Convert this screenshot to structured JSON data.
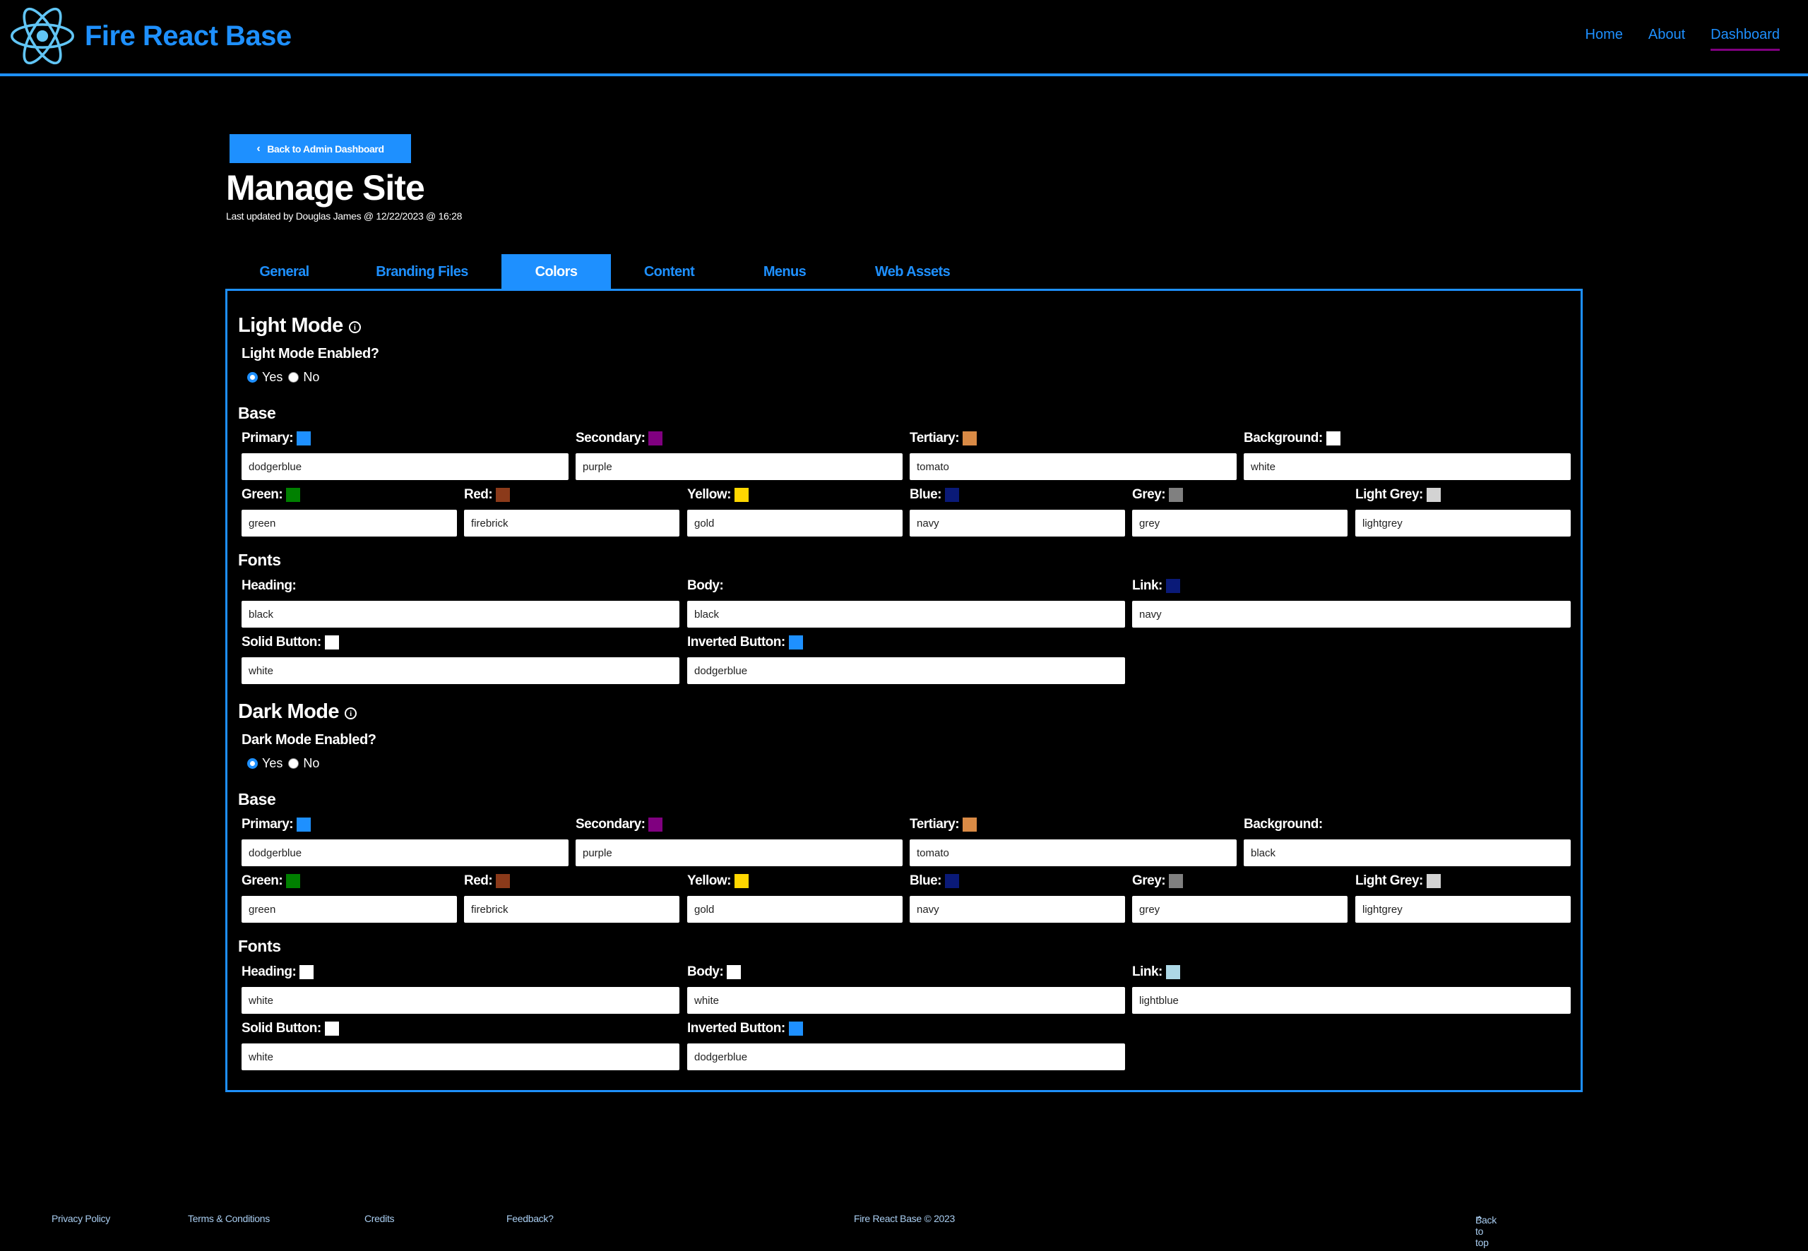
{
  "header": {
    "brand_title": "Fire React Base",
    "nav": [
      {
        "label": "Home",
        "active": false
      },
      {
        "label": "About",
        "active": false
      },
      {
        "label": "Dashboard",
        "active": true
      }
    ]
  },
  "page": {
    "back_button_label": "Back to Admin Dashboard",
    "title": "Manage Site",
    "last_updated": "Last updated by Douglas James @ 12/22/2023 @ 16:28"
  },
  "tabs": [
    {
      "label": "General",
      "active": false
    },
    {
      "label": "Branding Files",
      "active": false
    },
    {
      "label": "Colors",
      "active": true
    },
    {
      "label": "Content",
      "active": false
    },
    {
      "label": "Menus",
      "active": false
    },
    {
      "label": "Web Assets",
      "active": false
    }
  ],
  "light_mode": {
    "title": "Light Mode",
    "enabled_question": "Light Mode Enabled?",
    "yes_label": "Yes",
    "no_label": "No",
    "enabled": "Yes",
    "base_heading": "Base",
    "fonts_heading": "Fonts",
    "base": {
      "primary": {
        "label": "Primary:",
        "value": "dodgerblue",
        "swatch": "#1e90ff"
      },
      "secondary": {
        "label": "Secondary:",
        "value": "purple",
        "swatch": "#800080"
      },
      "tertiary": {
        "label": "Tertiary:",
        "value": "tomato",
        "swatch": "#d98a45"
      },
      "background": {
        "label": "Background:",
        "value": "white",
        "swatch": "#ffffff"
      },
      "green": {
        "label": "Green:",
        "value": "green",
        "swatch": "#008000"
      },
      "red": {
        "label": "Red:",
        "value": "firebrick",
        "swatch": "#8b3a1a"
      },
      "yellow": {
        "label": "Yellow:",
        "value": "gold",
        "swatch": "#ffd700"
      },
      "blue": {
        "label": "Blue:",
        "value": "navy",
        "swatch": "#0a1a78"
      },
      "grey": {
        "label": "Grey:",
        "value": "grey",
        "swatch": "#808080"
      },
      "lightgrey": {
        "label": "Light Grey:",
        "value": "lightgrey",
        "swatch": "#d3d3d3"
      }
    },
    "fonts": {
      "heading": {
        "label": "Heading:",
        "value": "black",
        "swatch": "#000000"
      },
      "body": {
        "label": "Body:",
        "value": "black",
        "swatch": "#000000"
      },
      "link": {
        "label": "Link:",
        "value": "navy",
        "swatch": "#0a1a78"
      },
      "solid_button": {
        "label": "Solid Button:",
        "value": "white",
        "swatch": "#ffffff"
      },
      "inverted_button": {
        "label": "Inverted Button:",
        "value": "dodgerblue",
        "swatch": "#1e90ff"
      }
    }
  },
  "dark_mode": {
    "title": "Dark Mode",
    "enabled_question": "Dark Mode Enabled?",
    "yes_label": "Yes",
    "no_label": "No",
    "enabled": "Yes",
    "base_heading": "Base",
    "fonts_heading": "Fonts",
    "base": {
      "primary": {
        "label": "Primary:",
        "value": "dodgerblue",
        "swatch": "#1e90ff"
      },
      "secondary": {
        "label": "Secondary:",
        "value": "purple",
        "swatch": "#800080"
      },
      "tertiary": {
        "label": "Tertiary:",
        "value": "tomato",
        "swatch": "#d98a45"
      },
      "background": {
        "label": "Background:",
        "value": "black",
        "swatch": "#000000"
      },
      "green": {
        "label": "Green:",
        "value": "green",
        "swatch": "#008000"
      },
      "red": {
        "label": "Red:",
        "value": "firebrick",
        "swatch": "#8b3a1a"
      },
      "yellow": {
        "label": "Yellow:",
        "value": "gold",
        "swatch": "#ffd700"
      },
      "blue": {
        "label": "Blue:",
        "value": "navy",
        "swatch": "#0a1a78"
      },
      "grey": {
        "label": "Grey:",
        "value": "grey",
        "swatch": "#808080"
      },
      "lightgrey": {
        "label": "Light Grey:",
        "value": "lightgrey",
        "swatch": "#d3d3d3"
      }
    },
    "fonts": {
      "heading": {
        "label": "Heading:",
        "value": "white",
        "swatch": "#ffffff"
      },
      "body": {
        "label": "Body:",
        "value": "white",
        "swatch": "#ffffff"
      },
      "link": {
        "label": "Link:",
        "value": "lightblue",
        "swatch": "#add8e6"
      },
      "solid_button": {
        "label": "Solid Button:",
        "value": "white",
        "swatch": "#ffffff"
      },
      "inverted_button": {
        "label": "Inverted Button:",
        "value": "dodgerblue",
        "swatch": "#1e90ff"
      }
    }
  },
  "footer": {
    "links": [
      "Privacy Policy",
      "Terms & Conditions",
      "Credits",
      "Feedback?"
    ],
    "copyright": "Fire React Base © 2023",
    "back_to_top": "Back to top"
  },
  "colors": {
    "accent": "#1e90ff",
    "nav_active_underline": "#800080",
    "footer_link": "#a9cdf0",
    "background": "#000000"
  }
}
